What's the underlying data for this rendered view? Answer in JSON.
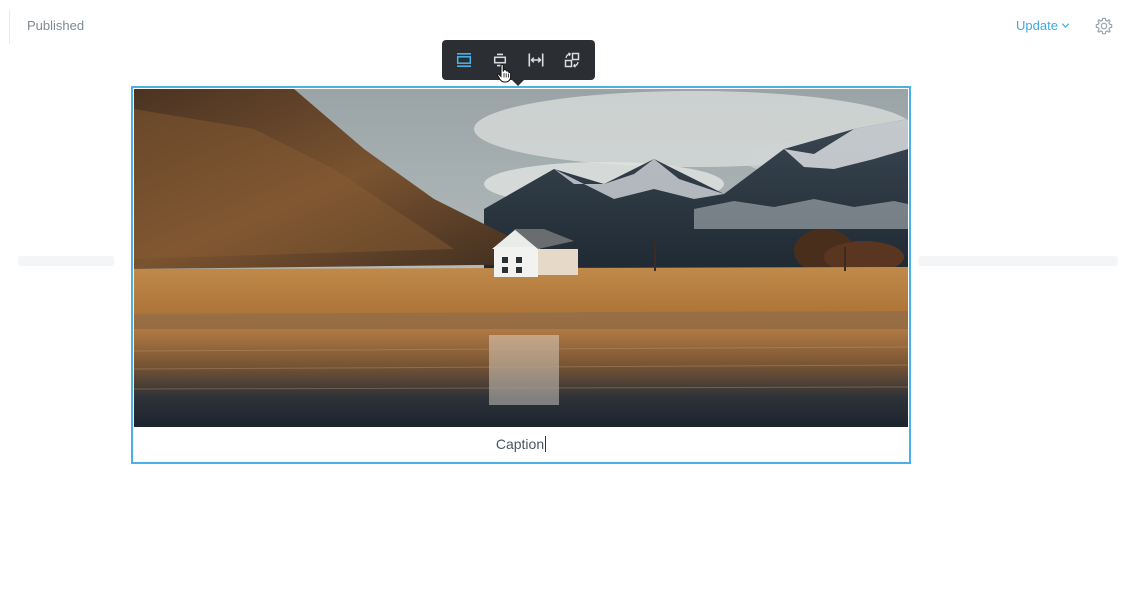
{
  "header": {
    "status_label": "Published",
    "update_label": "Update"
  },
  "icons": {
    "update_menu": "chevron-down-icon",
    "settings": "gear-icon"
  },
  "toolbar": {
    "buttons": [
      {
        "name": "align-wide",
        "icon": "align-wide-icon",
        "active": true
      },
      {
        "name": "align-center",
        "icon": "align-center-icon",
        "active": false
      },
      {
        "name": "full-width",
        "icon": "full-width-icon",
        "active": false
      },
      {
        "name": "replace-image",
        "icon": "replace-image-icon",
        "active": false
      }
    ]
  },
  "image_block": {
    "alt": "House by a lake in front of snowy mountains",
    "caption": "Caption"
  },
  "colors": {
    "accent": "#3eaae0",
    "selection_border": "#4bb1e4",
    "toolbar_bg": "#2b2f33",
    "active_tool": "#45b5ec",
    "muted_text": "#7f8b94"
  }
}
